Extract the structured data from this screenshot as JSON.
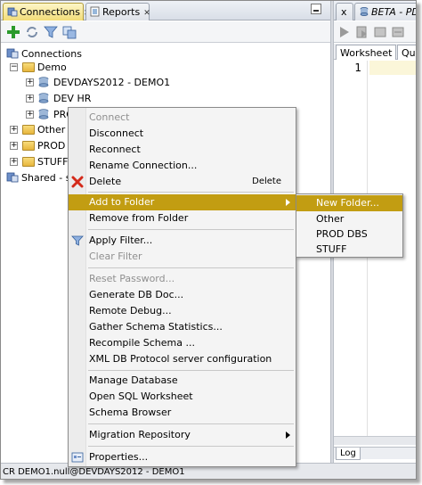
{
  "tabs": {
    "connections": "Connections",
    "reports": "Reports",
    "x": "x",
    "beta": "BETA - PDB"
  },
  "tree": {
    "root": "Connections",
    "demo_folder": "Demo",
    "items": [
      "DEVDAYS2012 - DEMO1",
      "DEV HR",
      "PROD HR"
    ],
    "other": "Other",
    "prod_dbs": "PROD D",
    "stuff": "STUFF",
    "shared": "Shared - sec"
  },
  "worksheet": {
    "tab1": "Worksheet",
    "tab2": "Qu",
    "line": "1",
    "log": "Log"
  },
  "statusbar": {
    "text": "CR DEMO1.null@DEVDAYS2012 - DEMO1"
  },
  "menu": {
    "connect": "Connect",
    "disconnect": "Disconnect",
    "reconnect": "Reconnect",
    "rename": "Rename Connection...",
    "delete": "Delete",
    "delete_shortcut": "Delete",
    "add_to_folder": "Add to Folder",
    "remove_from_folder": "Remove from Folder",
    "apply_filter": "Apply Filter...",
    "clear_filter": "Clear Filter",
    "reset_password": "Reset Password...",
    "generate_db_doc": "Generate DB Doc...",
    "remote_debug": "Remote Debug...",
    "gather_stats": "Gather Schema Statistics...",
    "recompile_schema": "Recompile Schema ...",
    "xml_db": "XML DB Protocol server configuration",
    "manage_db": "Manage Database",
    "open_sql_ws": "Open SQL Worksheet",
    "schema_browser": "Schema Browser",
    "migration_repo": "Migration Repository",
    "properties": "Properties..."
  },
  "submenu": {
    "items": [
      "New Folder...",
      "Other",
      "PROD DBS",
      "STUFF"
    ]
  }
}
